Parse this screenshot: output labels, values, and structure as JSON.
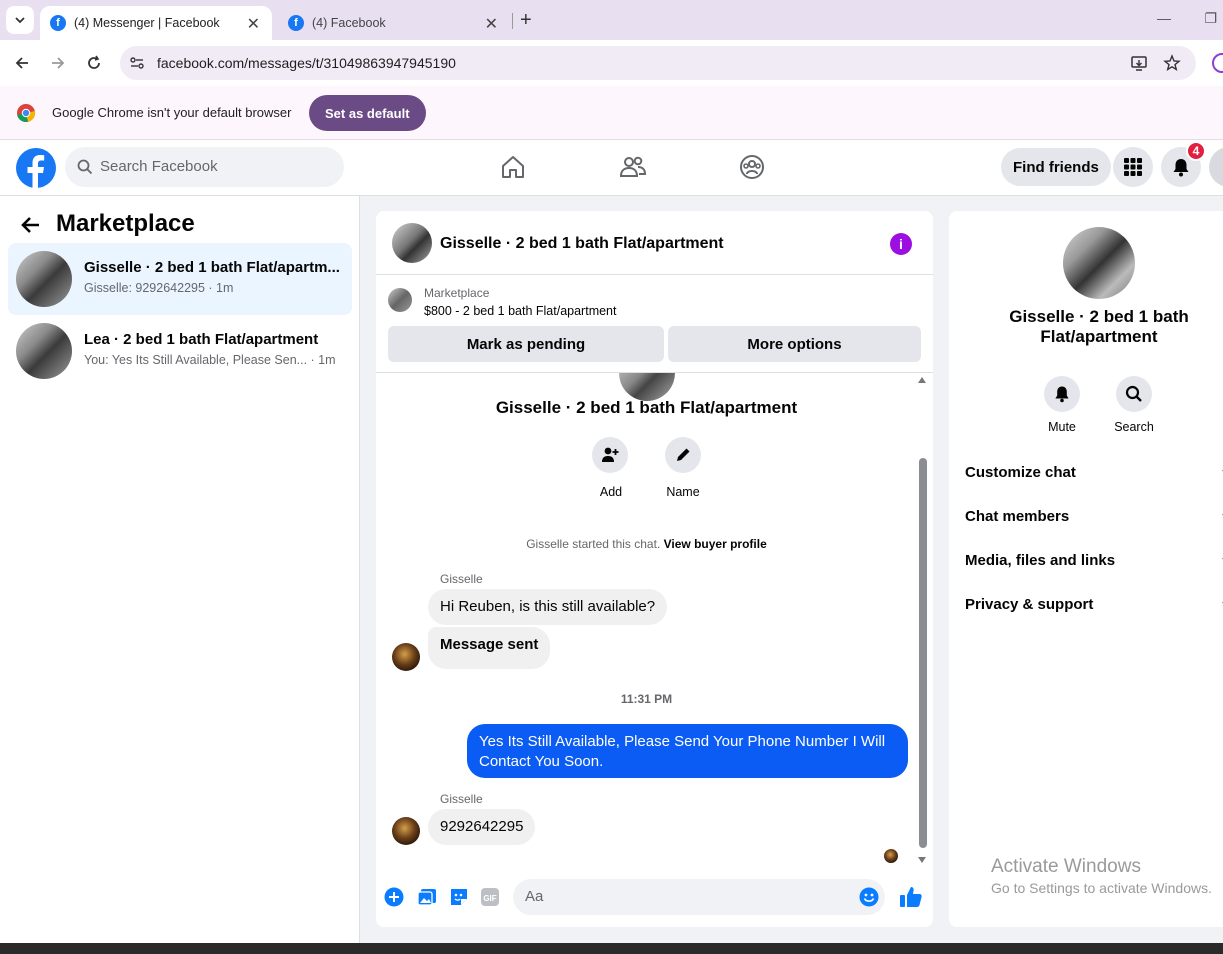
{
  "browser": {
    "tabs": [
      {
        "title": "(4) Messenger | Facebook",
        "active": true
      },
      {
        "title": "(4) Facebook",
        "active": false
      }
    ],
    "url": "facebook.com/messages/t/31049863947945190",
    "infobar": {
      "message": "Google Chrome isn't your default browser",
      "button": "Set as default"
    }
  },
  "header": {
    "search_placeholder": "Search Facebook",
    "find_friends": "Find friends",
    "notification_count": "4",
    "brand_color": "#1877f2"
  },
  "sidebar": {
    "title": "Marketplace",
    "conversations": [
      {
        "name": "Gisselle · 2 bed 1 bath Flat/apartm...",
        "preview": "Gisselle: 9292642295 · 1m",
        "selected": true
      },
      {
        "name": "Lea · 2 bed 1 bath Flat/apartment",
        "preview": "You: Yes Its Still Available, Please Sen...  · 1m",
        "selected": false
      }
    ]
  },
  "chat": {
    "title": "Gisselle · 2 bed 1 bath Flat/apartment",
    "listing": {
      "label": "Marketplace",
      "price_line": "$800 - 2 bed 1 bath Flat/apartment",
      "mark_pending": "Mark as pending",
      "more_options": "More options"
    },
    "intro": {
      "name": "Gisselle · 2 bed 1 bath Flat/apartment",
      "add": "Add",
      "rename": "Name"
    },
    "started_text": "Gisselle started this chat.",
    "buyer_profile": "View buyer profile",
    "messages": [
      {
        "sender": "Gisselle",
        "text": "Hi Reuben, is this still available?"
      },
      {
        "sender": "",
        "text": "Message sent"
      },
      {
        "timestamp": "11:31 PM"
      },
      {
        "sender": "You",
        "text": "Yes Its Still Available, Please Send Your Phone Number I Will Contact You Soon."
      },
      {
        "sender": "Gisselle",
        "text": "9292642295"
      }
    ],
    "composer_placeholder": "Aa",
    "outgoing_color": "#0a5cf5"
  },
  "details": {
    "name": "Gisselle · 2 bed 1 bath Flat/apartment",
    "mute": "Mute",
    "search": "Search",
    "sections": [
      "Customize chat",
      "Chat members",
      "Media, files and links",
      "Privacy & support"
    ]
  },
  "watermark": {
    "line1": "Activate Windows",
    "line2": "Go to Settings to activate Windows."
  }
}
